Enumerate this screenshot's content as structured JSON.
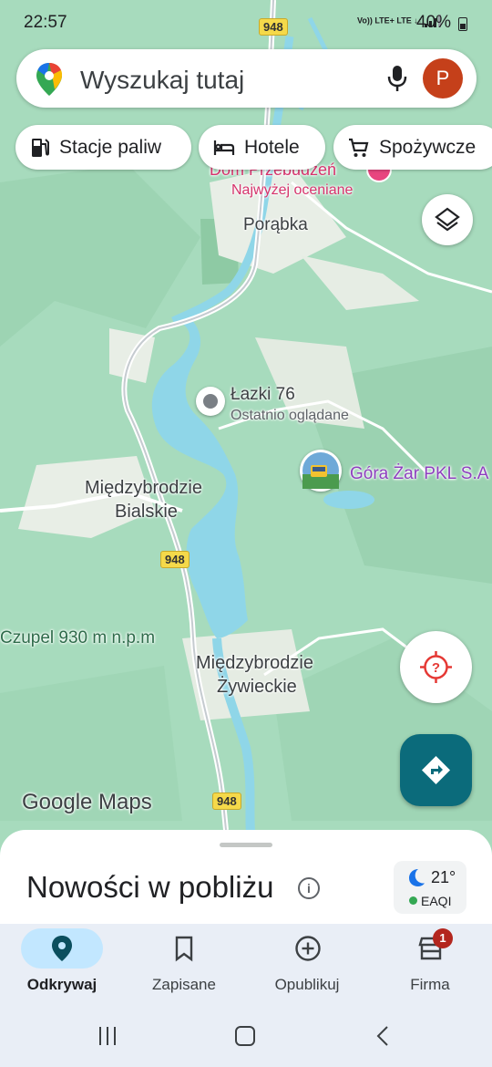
{
  "status_bar": {
    "time": "22:57",
    "signal_text": "Vo)) LTE+ LTE ↓↑",
    "battery": "40%"
  },
  "search": {
    "placeholder": "Wyszukaj tutaj",
    "avatar_letter": "P"
  },
  "chips": [
    {
      "label": "Stacje paliw",
      "icon": "gas-station-icon"
    },
    {
      "label": "Hotele",
      "icon": "bed-icon"
    },
    {
      "label": "Spożywcze",
      "icon": "cart-icon"
    }
  ],
  "map": {
    "places": {
      "dom_name": "Dom Przebudzeń",
      "dom_sub": "Najwyżej oceniane",
      "porabka": "Porąbka",
      "lazki": "Łazki 76",
      "lazki_sub": "Ostatnio oglądane",
      "gora_zar": "Góra Żar PKL S.A",
      "mb_bialskie_1": "Międzybrodzie",
      "mb_bialskie_2": "Bialskie",
      "czupel": "Czupel 930 m n.p.m",
      "mb_zywieckie_1": "Międzybrodzie",
      "mb_zywieckie_2": "Żywieckie"
    },
    "road": "948",
    "logo": "Google Maps"
  },
  "sheet": {
    "title": "Nowości w pobliżu",
    "weather_temp": "21°",
    "weather_aq": "EAQI"
  },
  "nav": [
    {
      "label": "Odkrywaj",
      "icon": "explore-pin-icon",
      "active": true
    },
    {
      "label": "Zapisane",
      "icon": "bookmark-icon",
      "active": false
    },
    {
      "label": "Opublikuj",
      "icon": "add-circle-icon",
      "active": false
    },
    {
      "label": "Firma",
      "icon": "store-icon",
      "active": false,
      "badge": "1"
    }
  ],
  "colors": {
    "accent": "#0b6b7b",
    "avatar": "#c5401a",
    "nav_active_pill": "#c2e7ff",
    "poi_pink": "#d6336c",
    "poi_purple": "#8e3fbf",
    "water": "#8fd6e8"
  }
}
